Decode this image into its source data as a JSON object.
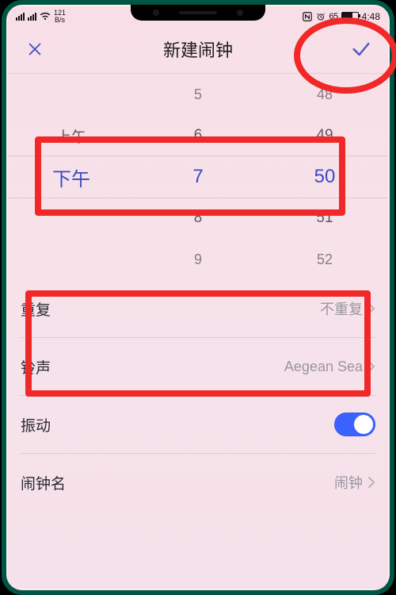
{
  "status": {
    "net_rate": "121",
    "net_unit": "B/s",
    "battery_pct": "65",
    "time": "4:48"
  },
  "title": "新建闹钟",
  "picker": {
    "ampm": {
      "far_up": "",
      "near_up": "上午",
      "sel": "下午",
      "near_dn": "",
      "far_dn": ""
    },
    "hour": {
      "far_up": "5",
      "near_up": "6",
      "sel": "7",
      "near_dn": "8",
      "far_dn": "9"
    },
    "minute": {
      "far_up": "48",
      "near_up": "49",
      "sel": "50",
      "near_dn": "51",
      "far_dn": "52"
    }
  },
  "settings": {
    "repeat": {
      "label": "重复",
      "value": "不重复"
    },
    "ringtone": {
      "label": "铃声",
      "value": "Aegean Sea"
    },
    "vibrate": {
      "label": "振动",
      "on": true
    },
    "name": {
      "label": "闹钟名",
      "value": "闹钟"
    }
  }
}
